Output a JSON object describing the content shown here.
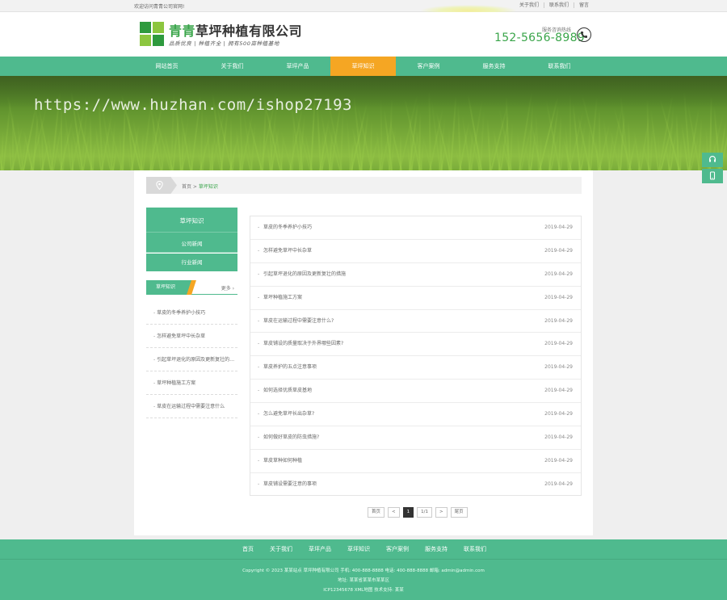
{
  "topbar": {
    "welcome": "欢迎访问青青公司官网!",
    "links": [
      "关于我们",
      "联系我们",
      "留言"
    ]
  },
  "header": {
    "brand_highlight": "青青",
    "brand_rest": "草坪种植有限公司",
    "slogan": "品质优良 | 种植齐全 | 拥有500亩种植基地",
    "hotline_label": "服务咨询热线",
    "hotline": "152-5656-8989"
  },
  "nav": {
    "items": [
      "网站首页",
      "关于我们",
      "草坪产品",
      "草坪知识",
      "客户案例",
      "服务支持",
      "联系我们"
    ],
    "active_index": 3
  },
  "banner": {
    "watermark": "https://www.huzhan.com/ishop27193"
  },
  "breadcrumb": {
    "home": "首页",
    "sep": " > ",
    "current": "草坪知识"
  },
  "sidebar": {
    "title": "草坪知识",
    "subcats": [
      "公司新闻",
      "行业新闻"
    ],
    "hot_title": "草坪知识",
    "more": "更多 ›",
    "hot_items": [
      "草皮的冬季养护小技巧",
      "怎样避免草坪中长杂草",
      "引起草坪退化的原因及更新复壮的措施",
      "草坪种植施工方案",
      "草皮在运输过程中需要注意什么"
    ]
  },
  "articles": [
    {
      "title": "草皮的冬季养护小技巧",
      "date": "2019-04-29"
    },
    {
      "title": "怎样避免草坪中长杂草",
      "date": "2019-04-29"
    },
    {
      "title": "引起草坪退化的原因及更新复壮的措施",
      "date": "2019-04-29"
    },
    {
      "title": "草坪种植施工方案",
      "date": "2019-04-29"
    },
    {
      "title": "草皮在运输过程中需要注意什么?",
      "date": "2019-04-29"
    },
    {
      "title": "草皮铺设的质量取决于外界哪些因素?",
      "date": "2019-04-29"
    },
    {
      "title": "草皮养护的五点注意事项",
      "date": "2019-04-29"
    },
    {
      "title": "如何选择优质草皮基地",
      "date": "2019-04-29"
    },
    {
      "title": "怎么避免草坪长出杂草?",
      "date": "2019-04-29"
    },
    {
      "title": "如何做好草皮的防虫措施?",
      "date": "2019-04-29"
    },
    {
      "title": "草皮草种如何种植",
      "date": "2019-04-29"
    },
    {
      "title": "草皮铺设需要注意的事项",
      "date": "2019-04-29"
    }
  ],
  "pager": [
    "首页",
    "<",
    "1",
    "1/1",
    ">",
    "尾页"
  ],
  "pager_active": 2,
  "footer_nav": [
    "首页",
    "关于我们",
    "草坪产品",
    "草坪知识",
    "客户案例",
    "服务支持",
    "联系我们"
  ],
  "footer": {
    "line1": "Copyright © 2023 某某站点 草坪种植有限公司 手机: 400-888-8888 电话: 400-888-8888 邮箱: admin@admin.com",
    "line2": "地址: 某某省某某市某某区",
    "line3": "ICP12345678 XML地图 技术支持: 某某"
  },
  "colors": {
    "brand_green": "#4fba8e",
    "accent_orange": "#f5a623",
    "text_green": "#3aa54a"
  }
}
